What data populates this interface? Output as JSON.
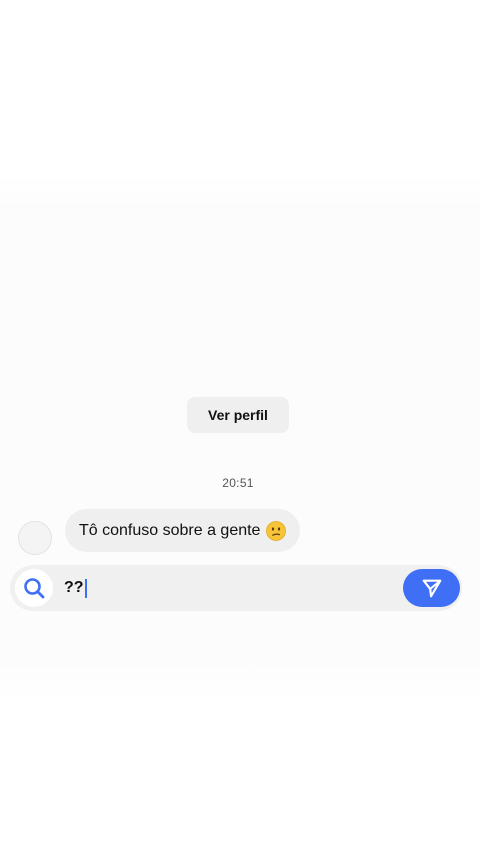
{
  "profile_button": {
    "label": "Ver perfil"
  },
  "thread": {
    "timestamp": "20:51",
    "messages": [
      {
        "text": "Tô confuso sobre a gente",
        "emoji": "confused-face-icon"
      }
    ]
  },
  "composer": {
    "value": "??",
    "search_icon": "search-icon",
    "send_icon": "send-icon"
  },
  "colors": {
    "accent": "#3f6ff4",
    "bubble": "#efefef",
    "composer": "#f0f0f0"
  }
}
